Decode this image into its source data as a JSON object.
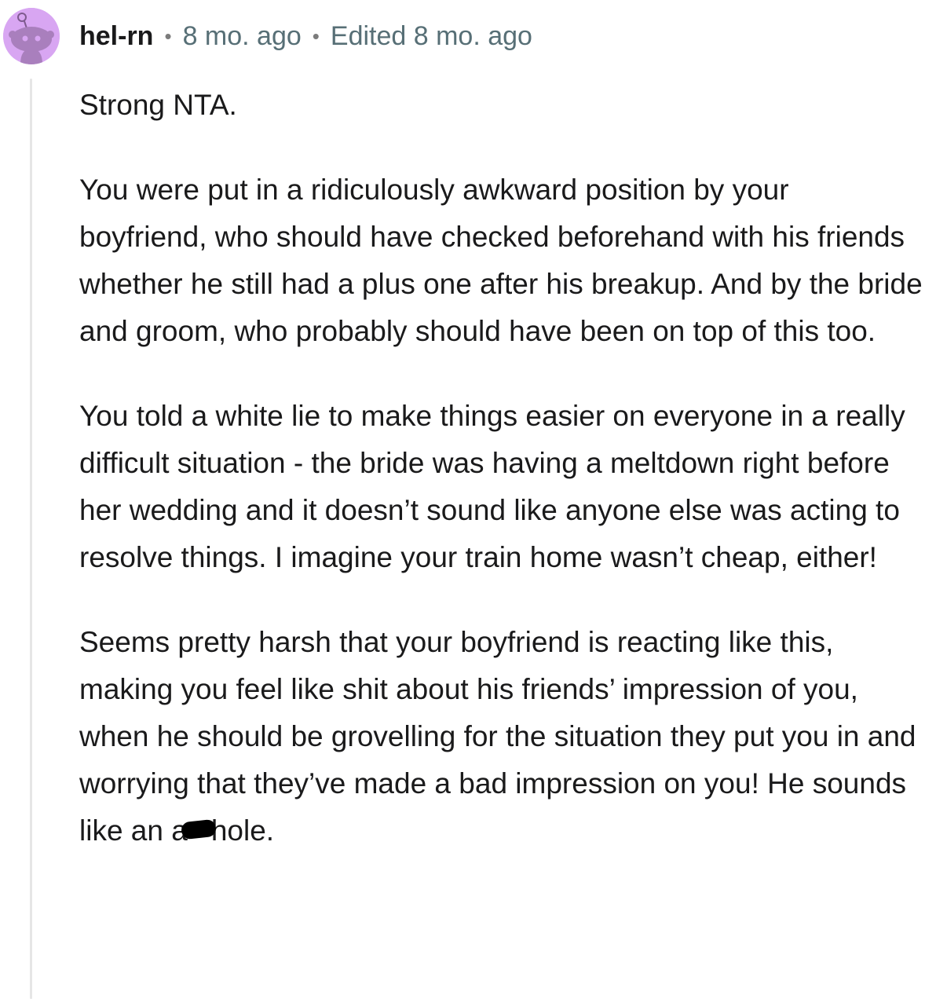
{
  "comment": {
    "avatar_icon": "reddit-snoo-avatar-icon",
    "avatar_color": "#d8a6f2",
    "username": "hel-rn",
    "separator": "•",
    "timestamp": "8 mo. ago",
    "edited": "Edited 8 mo. ago",
    "paragraphs": [
      "Strong NTA.",
      "You were put in a ridiculously awkward position by your boyfriend, who should have checked beforehand with his friends whether he still had a plus one after his breakup. And by the bride and groom, who probably should have been on top of this too.",
      "You told a white lie to make things easier on everyone in a really difficult situation - the bride was having a meltdown right before her wedding and it doesn’t sound like anyone else was acting to resolve things. I imagine your train home wasn’t cheap, either!",
      "Seems pretty harsh that your boyfriend is reacting like this, making you feel like shit about his friends’ impression of you, when he should be grovelling for the situation they put you in and worrying that they’ve made a bad impression on you! He sounds like an"
    ],
    "last_word_start": "a",
    "last_word_end": "hole."
  }
}
